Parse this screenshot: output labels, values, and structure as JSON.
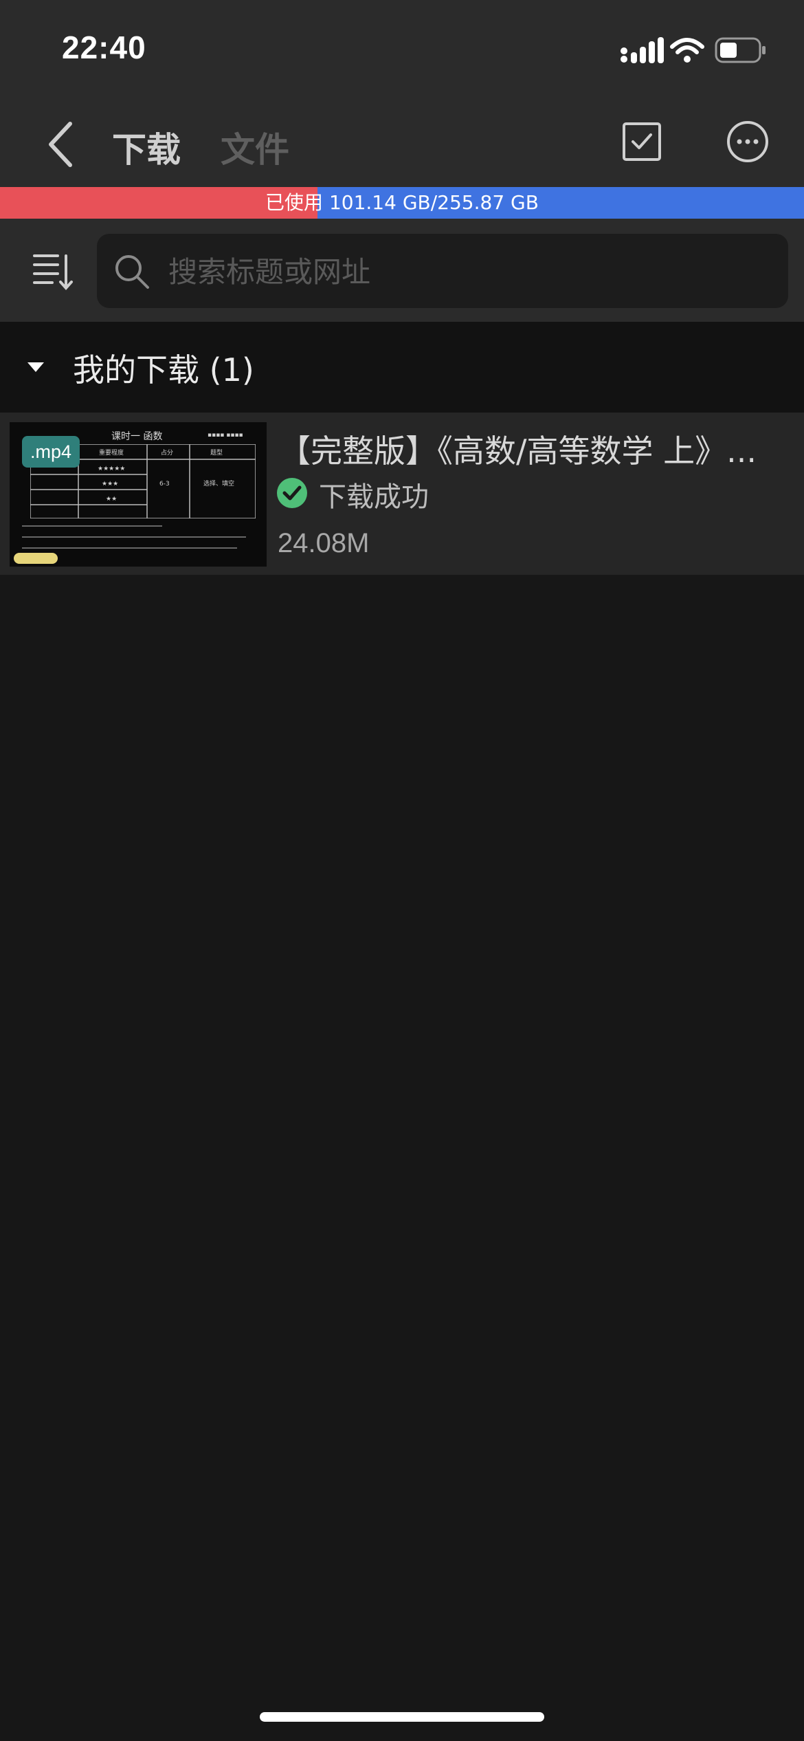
{
  "status_bar": {
    "time": "22:40"
  },
  "nav": {
    "tabs": [
      {
        "label": "下载",
        "active": true
      },
      {
        "label": "文件",
        "active": false
      }
    ]
  },
  "storage": {
    "label": "已使用 101.14 GB/255.87 GB",
    "used_fraction": 0.395,
    "used_color": "#e85158",
    "free_color": "#3f73e1"
  },
  "search": {
    "placeholder": "搜索标题或网址",
    "value": ""
  },
  "section": {
    "title": "我的下载 (1)"
  },
  "downloads": [
    {
      "format_badge": ".mp4",
      "title": "【完整版】《高数/高等数学 上》...",
      "status": "下载成功",
      "size": "24.08M",
      "status_color": "#4fbf78"
    }
  ]
}
